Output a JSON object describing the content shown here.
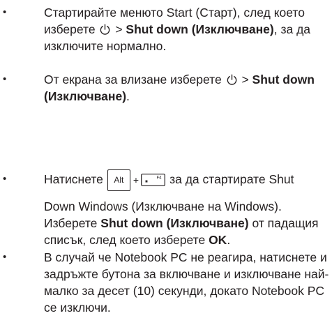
{
  "bullets": {
    "symbol": "•"
  },
  "item1": {
    "part1": "Стартирайте менюто Start (Старт), след което изберете ",
    "icon": "power-icon",
    "sep": " > ",
    "bold": "Shut down (Изключване)",
    "part2": ", за да изключите нормално."
  },
  "item2": {
    "part1": "От екрана за влизане изберете ",
    "icon": "power-icon",
    "sep": " > ",
    "bold": "Shut down (Изключване)",
    "part2": "."
  },
  "item3": {
    "part1": "Натиснете",
    "key1": "Alt",
    "plus": "+",
    "key2": "F4",
    "part2": "за да стартирате Shut",
    "line2a": "Down Windows (Изключване на Windows). Изберете ",
    "bold1": "Shut down (Изключване)",
    "line2b": " от падащия списък, след което изберете ",
    "bold2": "OK",
    "line2c": "."
  },
  "item4": {
    "text": "В случай че Notebook PC не реагира, натиснете и задръжте бутона за включване и изключване най-малко за десет (10) секунди, докато Notebook PC се изключи."
  }
}
